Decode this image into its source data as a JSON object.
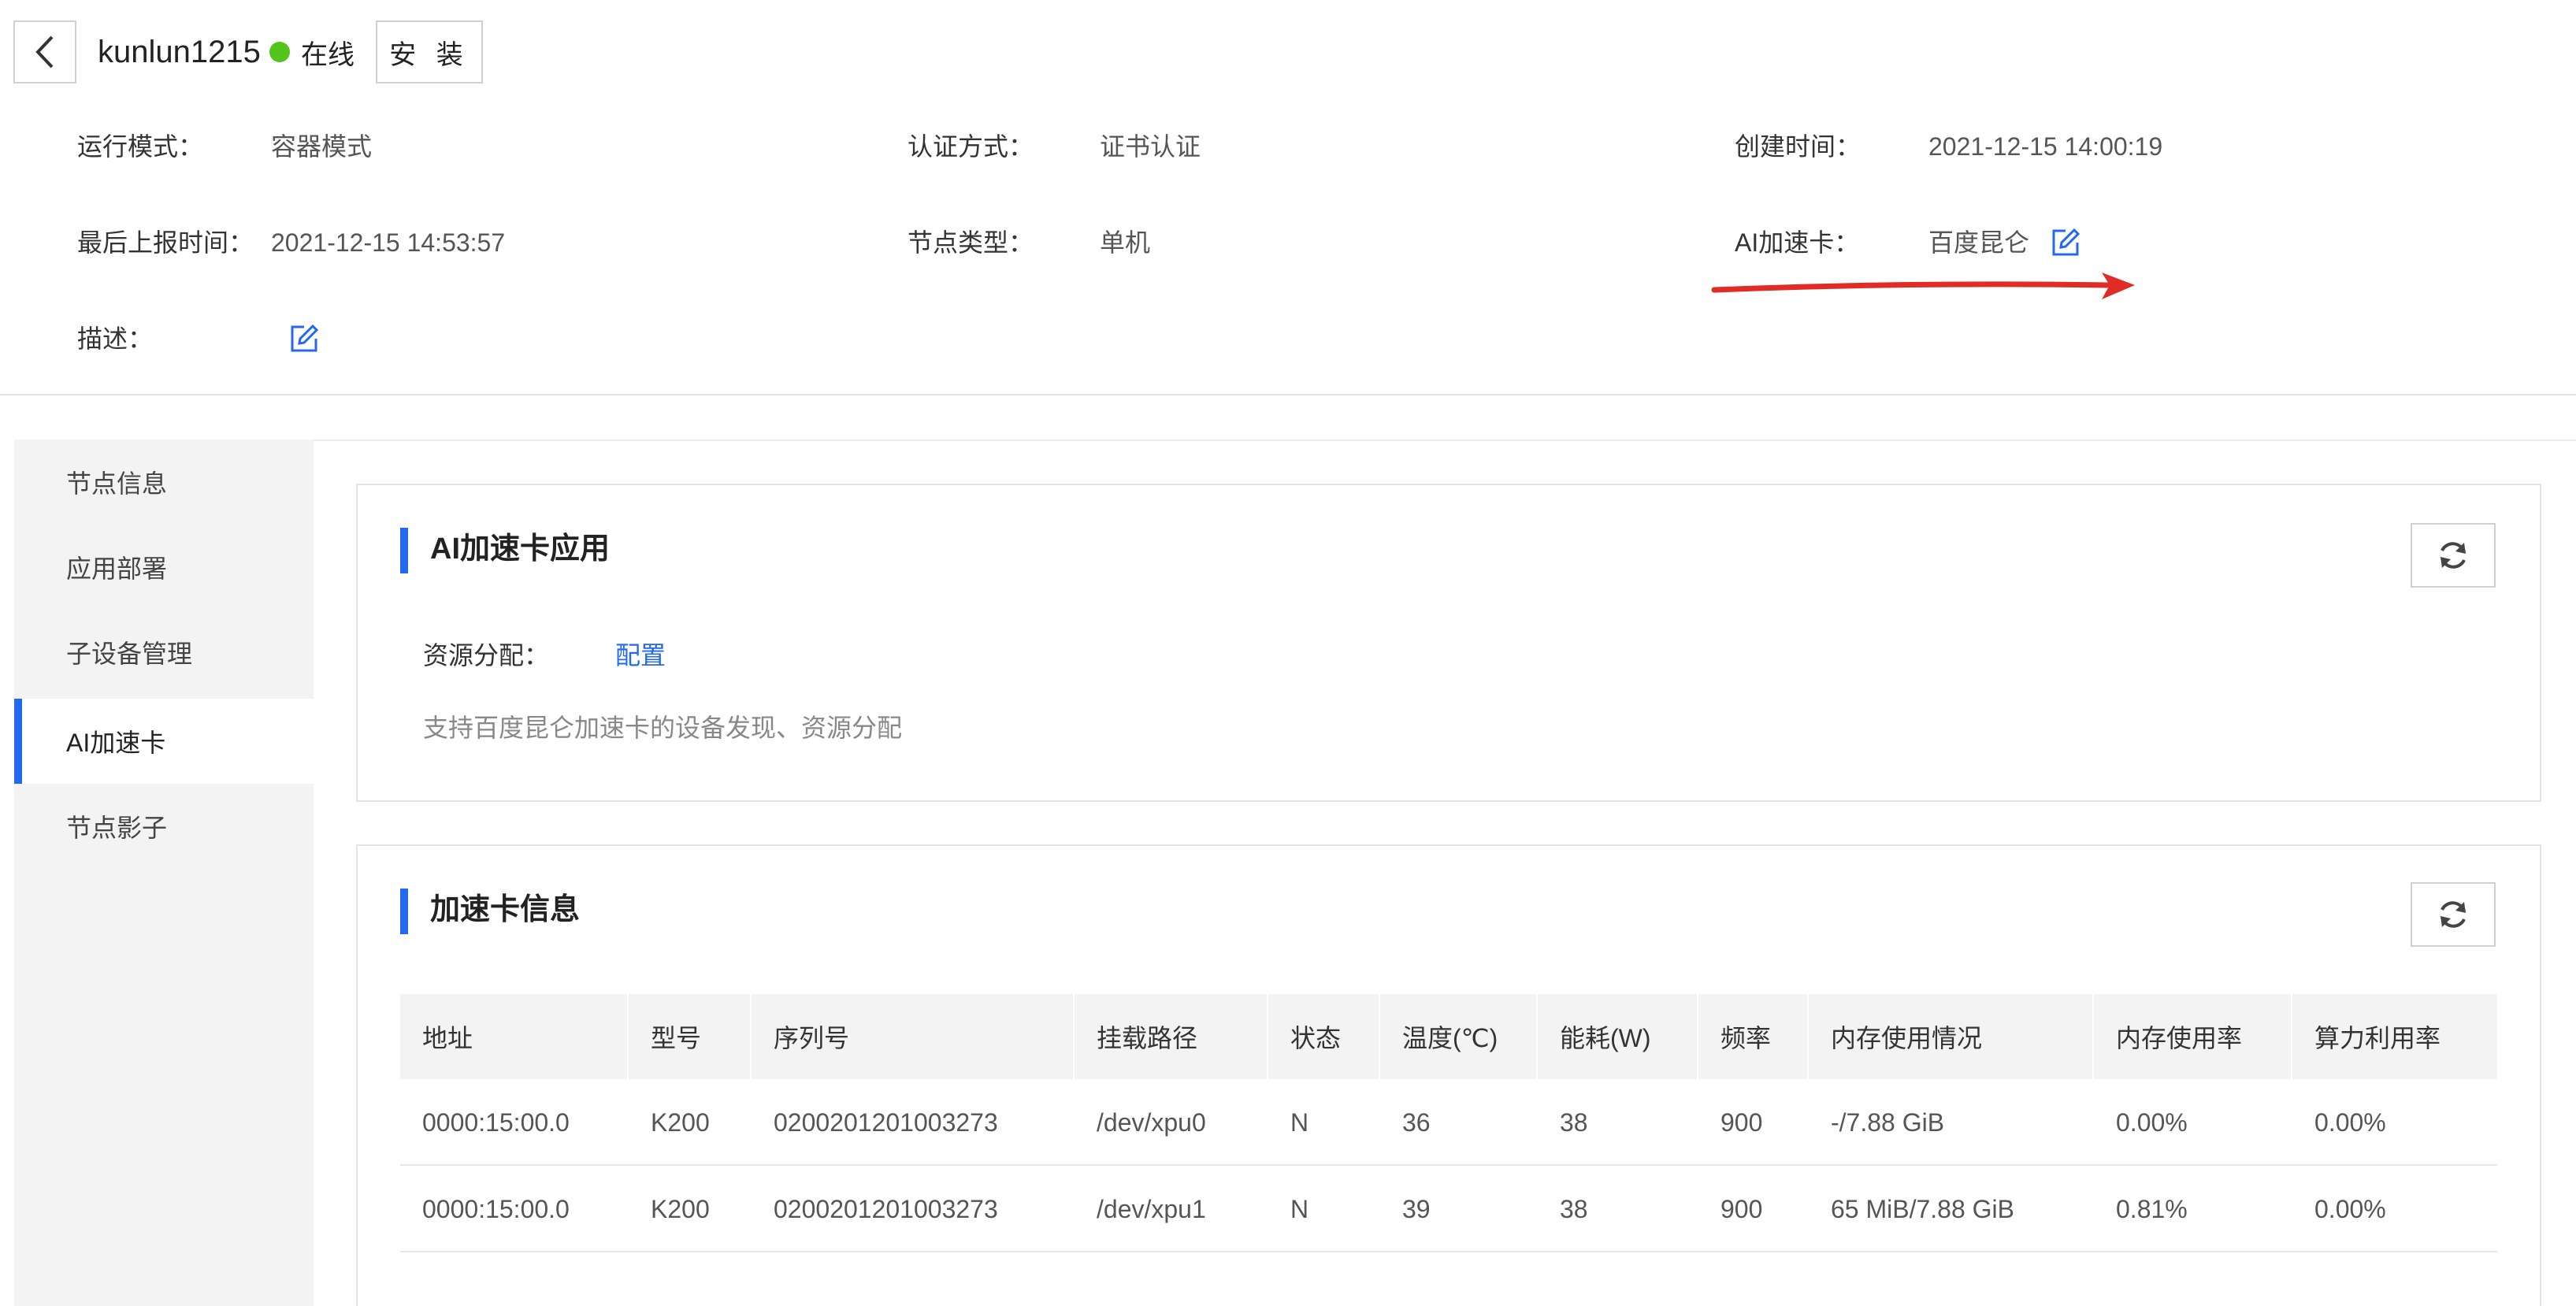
{
  "header": {
    "node_name": "kunlun1215",
    "status": "在线",
    "install_label": "安 装",
    "meta": {
      "run_mode_label": "运行模式：",
      "run_mode_value": "容器模式",
      "auth_label": "认证方式：",
      "auth_value": "证书认证",
      "created_label": "创建时间：",
      "created_value": "2021-12-15 14:00:19",
      "last_report_label": "最后上报时间：",
      "last_report_value": "2021-12-15 14:53:57",
      "node_type_label": "节点类型：",
      "node_type_value": "单机",
      "ai_card_label": "AI加速卡：",
      "ai_card_value": "百度昆仑",
      "desc_label": "描述："
    }
  },
  "sidebar": {
    "items": [
      {
        "label": "节点信息"
      },
      {
        "label": "应用部署"
      },
      {
        "label": "子设备管理"
      },
      {
        "label": "AI加速卡"
      },
      {
        "label": "节点影子"
      }
    ],
    "active_index": 3
  },
  "ai_app": {
    "title": "AI加速卡应用",
    "resource_label": "资源分配：",
    "config_link": "配置",
    "hint": "支持百度昆仑加速卡的设备发现、资源分配"
  },
  "card_info": {
    "title": "加速卡信息",
    "columns": [
      "地址",
      "型号",
      "序列号",
      "挂载路径",
      "状态",
      "温度(℃)",
      "能耗(W)",
      "频率",
      "内存使用情况",
      "内存使用率",
      "算力利用率"
    ],
    "rows": [
      [
        "0000:15:00.0",
        "K200",
        "0200201201003273",
        "/dev/xpu0",
        "N",
        "36",
        "38",
        "900",
        "-/7.88 GiB",
        "0.00%",
        "0.00%"
      ],
      [
        "0000:15:00.0",
        "K200",
        "0200201201003273",
        "/dev/xpu1",
        "N",
        "39",
        "38",
        "900",
        "65 MiB/7.88 GiB",
        "0.81%",
        "0.00%"
      ]
    ]
  },
  "colors": {
    "accent": "#2468f2",
    "online": "#52c41a",
    "annotation_arrow": "#e02b27"
  },
  "icons": [
    "back-arrow-icon",
    "status-dot-icon",
    "edit-icon",
    "refresh-icon"
  ]
}
